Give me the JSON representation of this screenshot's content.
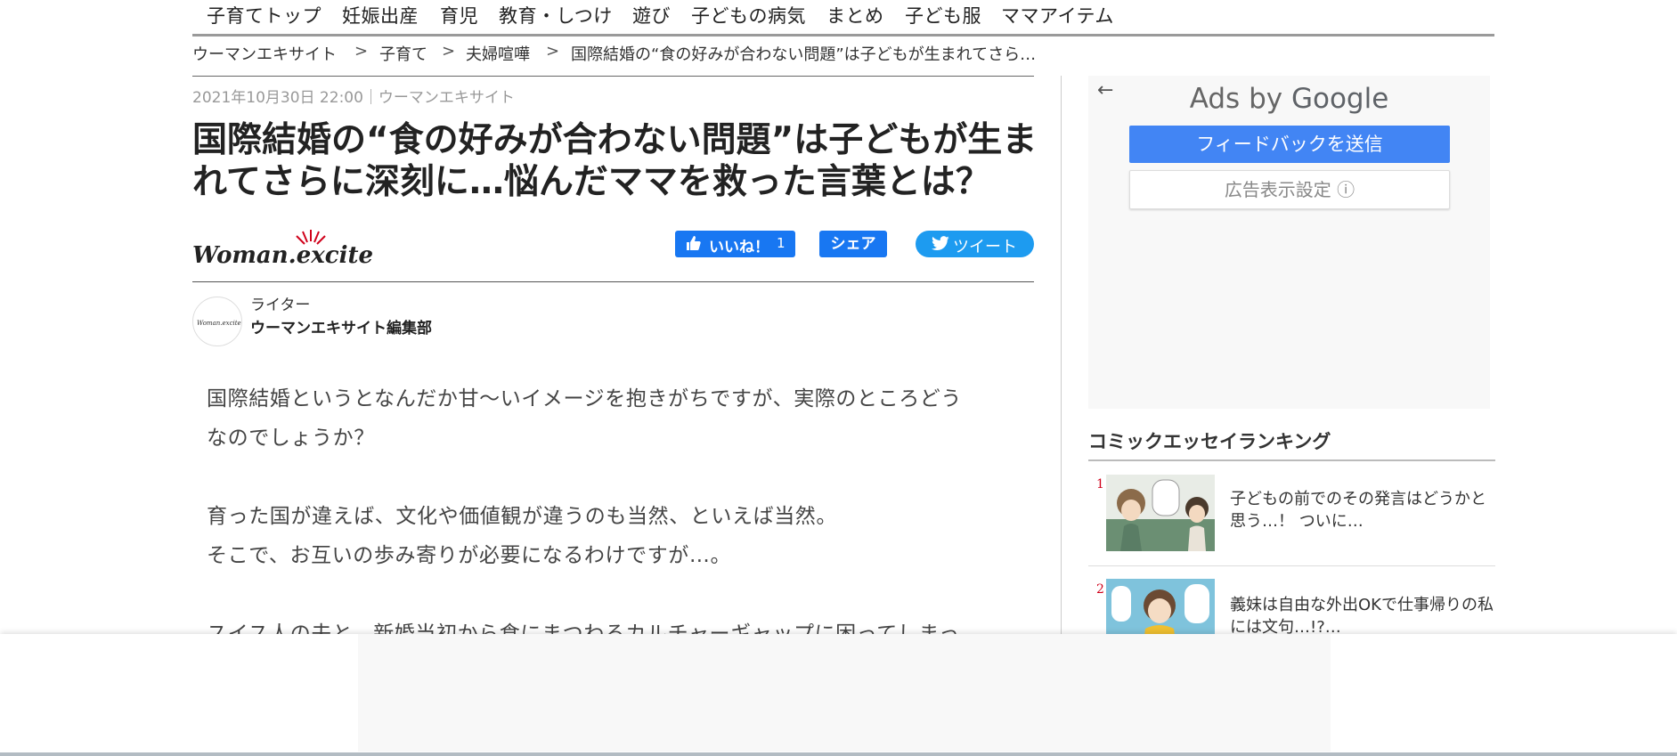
{
  "nav": {
    "items": [
      "子育てトップ",
      "妊娠出産",
      "育児",
      "教育・しつけ",
      "遊び",
      "子どもの病気",
      "まとめ",
      "子ども服",
      "ママアイテム"
    ]
  },
  "breadcrumb": {
    "items": [
      "ウーマンエキサイト",
      "子育て",
      "夫婦喧嘩",
      "国際結婚の“食の好みが合わない問題”は子どもが生まれてさら…"
    ],
    "separator": ">"
  },
  "article": {
    "meta": "2021年10月30日 22:00｜ウーマンエキサイト",
    "title": "国際結婚の“食の好みが合わない問題”は子どもが生まれてさらに深刻に…悩んだママを救った言葉とは？",
    "logo_text": "Woman.excite",
    "like_label": "いいね！",
    "like_count": "1",
    "share_label": "シェア",
    "tweet_label": "ツイート",
    "writer_label": "ライター",
    "writer_name": "ウーマンエキサイト編集部",
    "paragraphs": [
      "国際結婚というとなんだか甘〜いイメージを抱きがちですが、実際のところどう",
      "なのでしょうか？",
      "育った国が違えば、文化や価値観が違うのも当然、といえば当然。",
      "そこで、お互いの歩み寄りが必要になるわけですが…。",
      "スイス人の夫と、新婚当初から食にまつわるカルチャーギャップに困ってしまっ"
    ]
  },
  "ad": {
    "back_icon": "←",
    "title_prefix": "Ads by",
    "title_brand": "Google",
    "feedback_button": "フィードバックを送信",
    "settings_button": "広告表示設定 ⓘ"
  },
  "ranking": {
    "heading": "コミックエッセイランキング",
    "items": [
      {
        "rank": "1",
        "text": "子どもの前でのその発言はどうかと思う…！ ついに…"
      },
      {
        "rank": "2",
        "text": "義妹は自由な外出OKで仕事帰りの私には文句…!?…"
      }
    ]
  },
  "colors": {
    "facebook": "#1877f2",
    "twitter": "#1d9bf0",
    "google_blue": "#4285f4",
    "rank_red": "#d0021b"
  }
}
